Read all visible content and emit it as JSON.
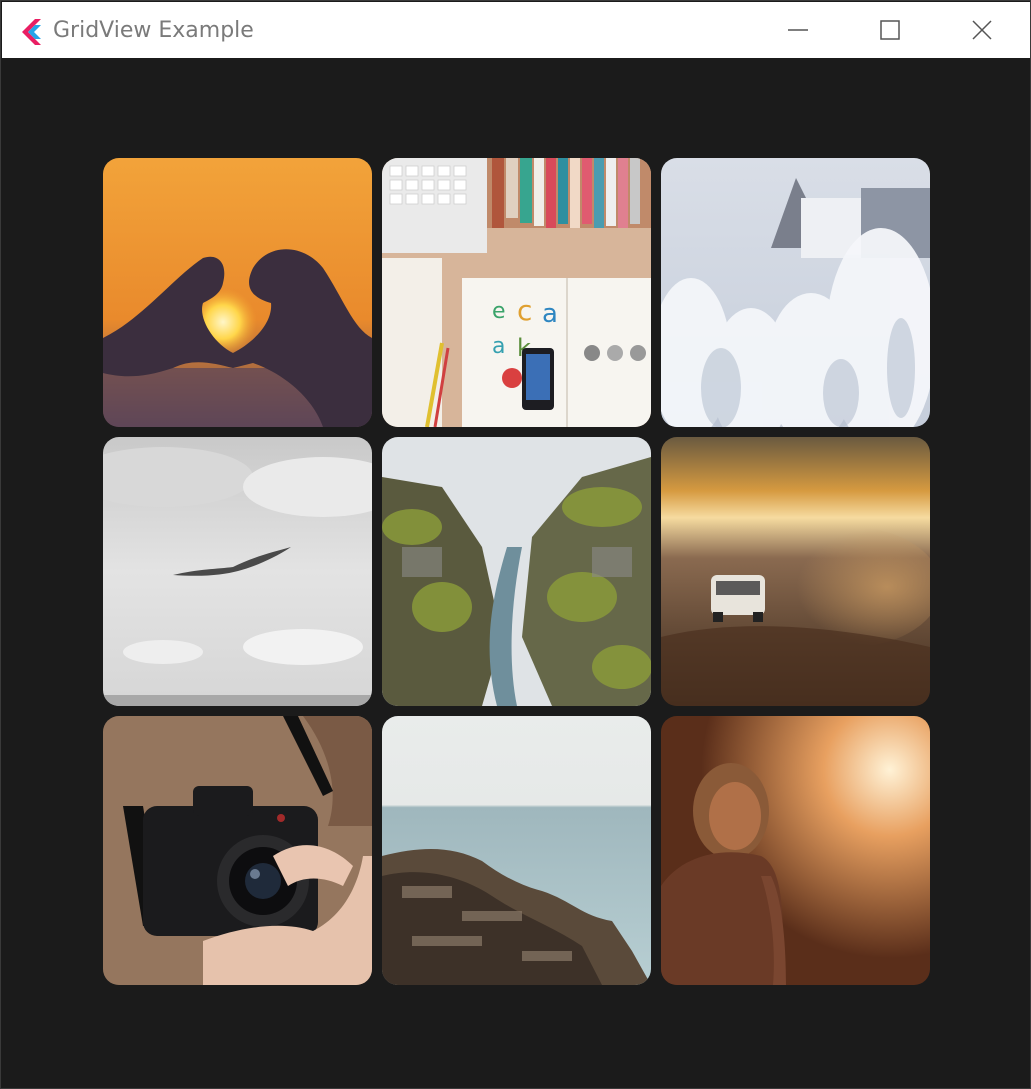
{
  "window": {
    "title": "GridView Example",
    "app_icon": "flutter-logo-icon",
    "controls": {
      "minimize": "minimize-icon",
      "maximize": "maximize-icon",
      "close": "close-icon"
    }
  },
  "grid": {
    "columns": 3,
    "tiles": [
      {
        "name": "photo-heart-sunset",
        "subject": "hands forming heart shape at sunset"
      },
      {
        "name": "photo-desk-flatlay",
        "subject": "desk flat lay with keyboard, books and phone"
      },
      {
        "name": "photo-frosted-trees",
        "subject": "frosted trees and house in winter"
      },
      {
        "name": "photo-seagull-sky",
        "subject": "bird flying over grey sea"
      },
      {
        "name": "photo-canyon-river",
        "subject": "mossy canyon with river"
      },
      {
        "name": "photo-van-desert",
        "subject": "van driving on dusty road at sunset"
      },
      {
        "name": "photo-camera-hands",
        "subject": "hands holding film camera"
      },
      {
        "name": "photo-rocky-coast",
        "subject": "rocky coastline and sea"
      },
      {
        "name": "photo-woman-sunset",
        "subject": "woman in warm sunset light"
      }
    ]
  }
}
